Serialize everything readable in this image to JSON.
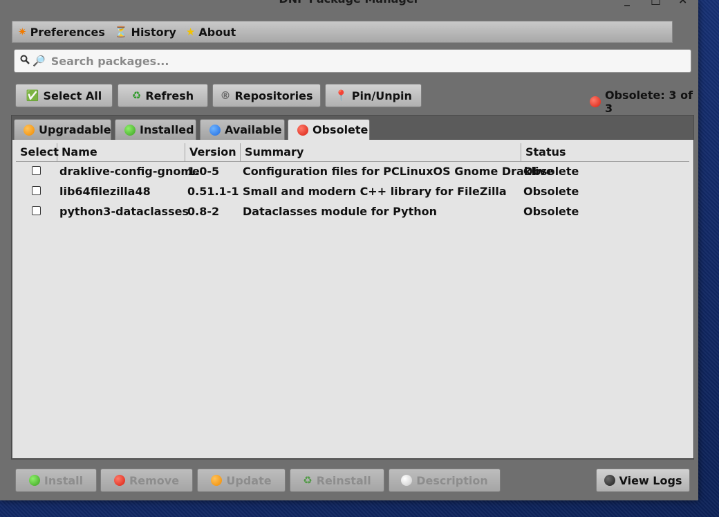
{
  "window": {
    "title": "DNF Package Manager",
    "controls": {
      "minimize": "_",
      "maximize": "□",
      "close": "×"
    }
  },
  "menubar": {
    "items": [
      {
        "label": "Preferences",
        "icon": "✷"
      },
      {
        "label": "History",
        "icon": "⏳"
      },
      {
        "label": "About",
        "icon": "★"
      }
    ]
  },
  "search": {
    "placeholder": "Search packages...",
    "value": "",
    "icons": {
      "left": "magnifier-icon",
      "prefix": "🔎"
    }
  },
  "toolbar": {
    "select_all": "Select All",
    "select_all_icon": "✅",
    "refresh": "Refresh",
    "refresh_icon": "♻",
    "repositories": "Repositories",
    "repositories_icon": "®",
    "pin_unpin": "Pin/Unpin",
    "pin_icon": "📍"
  },
  "status": {
    "text": "Obsolete: 3 of 3",
    "color": "#d81f10"
  },
  "tabs": [
    {
      "label": "Upgradable",
      "dot": "orange"
    },
    {
      "label": "Installed",
      "dot": "green"
    },
    {
      "label": "Available",
      "dot": "blue"
    },
    {
      "label": "Obsolete",
      "dot": "red",
      "active": true
    }
  ],
  "table": {
    "columns": [
      "Select",
      "Name",
      "Version",
      "Summary",
      "Status"
    ],
    "rows": [
      {
        "selected": false,
        "name": "draklive-config-gnome",
        "version": "1.0-5",
        "summary": "Configuration files for PCLinuxOS Gnome Draklive",
        "status": "Obsolete"
      },
      {
        "selected": false,
        "name": "lib64filezilla48",
        "version": "0.51.1-1",
        "summary": "Small and modern C++ library for FileZilla",
        "status": "Obsolete"
      },
      {
        "selected": false,
        "name": "python3-dataclasses",
        "version": "0.8-2",
        "summary": "Dataclasses module for Python",
        "status": "Obsolete"
      }
    ]
  },
  "actions": {
    "install": "Install",
    "remove": "Remove",
    "update": "Update",
    "reinstall": "Reinstall",
    "description": "Description",
    "view_logs": "View Logs",
    "reinstall_icon": "♻"
  },
  "colors": {
    "orange": "#f08a00",
    "green": "#3aa020",
    "blue": "#1f6ae0",
    "red": "#d81f10",
    "white": "#ffffff",
    "dark": "#1e1e1e"
  }
}
